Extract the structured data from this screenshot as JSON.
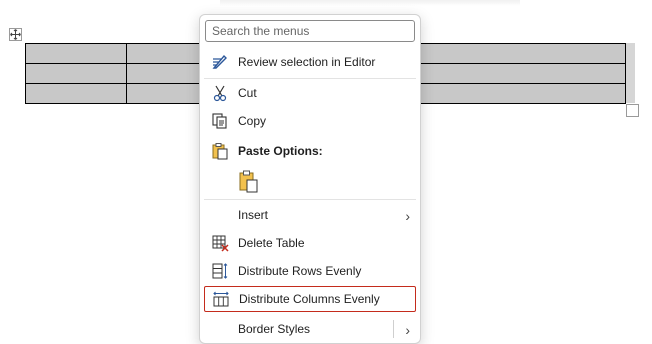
{
  "search": {
    "placeholder": "Search the menus"
  },
  "menu": {
    "items": [
      {
        "label": "Review selection in Editor",
        "icon": "editor-pen-icon"
      },
      {
        "label": "Cut",
        "icon": "scissors-icon"
      },
      {
        "label": "Copy",
        "icon": "copy-icon"
      },
      {
        "label": "Paste Options:",
        "icon": "clipboard-icon"
      },
      {
        "label": "Insert",
        "icon": ""
      },
      {
        "label": "Delete Table",
        "icon": "delete-table-icon"
      },
      {
        "label": "Distribute Rows Evenly",
        "icon": "distribute-rows-icon"
      },
      {
        "label": "Distribute Columns Evenly",
        "icon": "distribute-columns-icon"
      },
      {
        "label": "Border Styles",
        "icon": ""
      }
    ],
    "paste_option_icon": "keep-source-formatting-icon"
  },
  "colors": {
    "accent": "#2b579a",
    "highlight_border": "#c42b1c",
    "cell_fill": "#c8c8c8"
  }
}
